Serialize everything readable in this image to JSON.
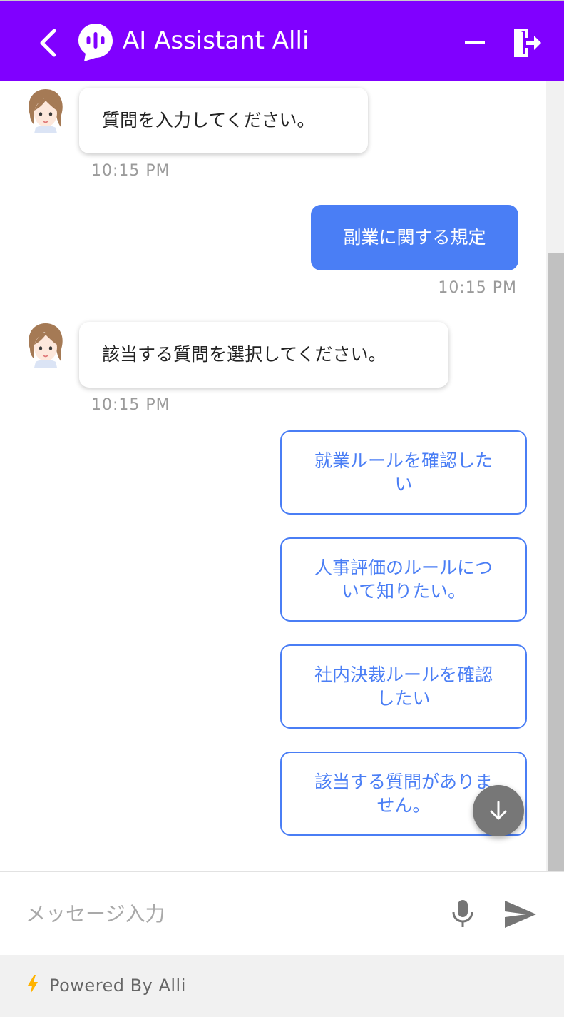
{
  "header": {
    "title": "AI Assistant Alli",
    "background": "#8000ff"
  },
  "icons": {
    "back": "chevron-left-icon",
    "logo": "chat-bubble-wave-icon",
    "minimize": "minimize-icon",
    "exit": "exit-door-icon",
    "scroll_down": "arrow-down-icon",
    "mic": "microphone-icon",
    "send": "send-icon",
    "bolt": "lightning-bolt-icon",
    "avatar": "assistant-avatar-icon"
  },
  "messages": [
    {
      "sender": "bot",
      "text": "質問を入力してください。",
      "time": "10:15 PM"
    },
    {
      "sender": "user",
      "text": "副業に関する規定",
      "time": "10:15 PM"
    },
    {
      "sender": "bot",
      "text": "該当する質問を選択してください。",
      "time": "10:15 PM"
    }
  ],
  "options": [
    "就業ルールを確認したい",
    "人事評価のルールについて知りたい。",
    "社内決裁ルールを確認したい",
    "該当する質問がありません。"
  ],
  "composer": {
    "placeholder": "メッセージ入力",
    "value": ""
  },
  "footer": {
    "powered_by": "Powered By Alli",
    "bolt_color": "#ffb300"
  },
  "colors": {
    "accent": "#4a7ef5",
    "user_bubble": "#4a7ef5",
    "header": "#8000ff"
  }
}
